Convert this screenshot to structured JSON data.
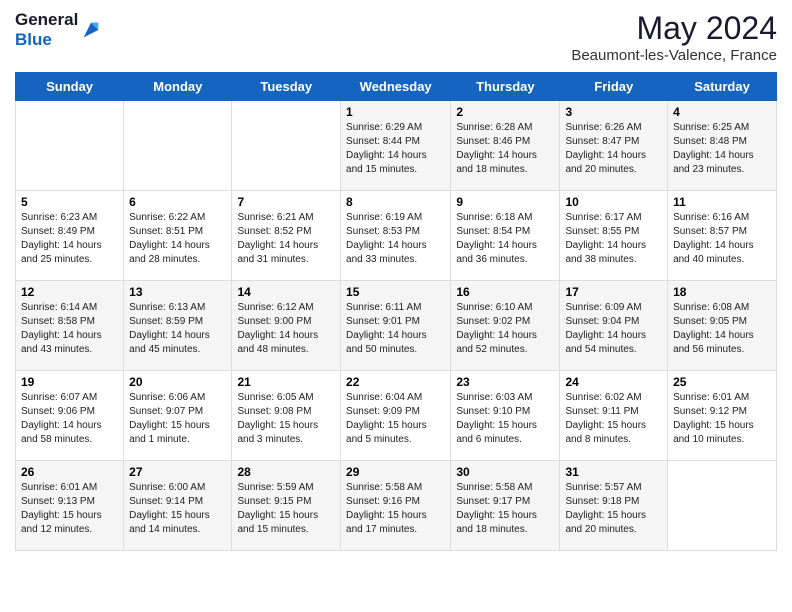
{
  "logo": {
    "line1": "General",
    "line2": "Blue"
  },
  "title": "May 2024",
  "location": "Beaumont-les-Valence, France",
  "weekdays": [
    "Sunday",
    "Monday",
    "Tuesday",
    "Wednesday",
    "Thursday",
    "Friday",
    "Saturday"
  ],
  "weeks": [
    [
      {
        "day": "",
        "info": ""
      },
      {
        "day": "",
        "info": ""
      },
      {
        "day": "",
        "info": ""
      },
      {
        "day": "1",
        "info": "Sunrise: 6:29 AM\nSunset: 8:44 PM\nDaylight: 14 hours\nand 15 minutes."
      },
      {
        "day": "2",
        "info": "Sunrise: 6:28 AM\nSunset: 8:46 PM\nDaylight: 14 hours\nand 18 minutes."
      },
      {
        "day": "3",
        "info": "Sunrise: 6:26 AM\nSunset: 8:47 PM\nDaylight: 14 hours\nand 20 minutes."
      },
      {
        "day": "4",
        "info": "Sunrise: 6:25 AM\nSunset: 8:48 PM\nDaylight: 14 hours\nand 23 minutes."
      }
    ],
    [
      {
        "day": "5",
        "info": "Sunrise: 6:23 AM\nSunset: 8:49 PM\nDaylight: 14 hours\nand 25 minutes."
      },
      {
        "day": "6",
        "info": "Sunrise: 6:22 AM\nSunset: 8:51 PM\nDaylight: 14 hours\nand 28 minutes."
      },
      {
        "day": "7",
        "info": "Sunrise: 6:21 AM\nSunset: 8:52 PM\nDaylight: 14 hours\nand 31 minutes."
      },
      {
        "day": "8",
        "info": "Sunrise: 6:19 AM\nSunset: 8:53 PM\nDaylight: 14 hours\nand 33 minutes."
      },
      {
        "day": "9",
        "info": "Sunrise: 6:18 AM\nSunset: 8:54 PM\nDaylight: 14 hours\nand 36 minutes."
      },
      {
        "day": "10",
        "info": "Sunrise: 6:17 AM\nSunset: 8:55 PM\nDaylight: 14 hours\nand 38 minutes."
      },
      {
        "day": "11",
        "info": "Sunrise: 6:16 AM\nSunset: 8:57 PM\nDaylight: 14 hours\nand 40 minutes."
      }
    ],
    [
      {
        "day": "12",
        "info": "Sunrise: 6:14 AM\nSunset: 8:58 PM\nDaylight: 14 hours\nand 43 minutes."
      },
      {
        "day": "13",
        "info": "Sunrise: 6:13 AM\nSunset: 8:59 PM\nDaylight: 14 hours\nand 45 minutes."
      },
      {
        "day": "14",
        "info": "Sunrise: 6:12 AM\nSunset: 9:00 PM\nDaylight: 14 hours\nand 48 minutes."
      },
      {
        "day": "15",
        "info": "Sunrise: 6:11 AM\nSunset: 9:01 PM\nDaylight: 14 hours\nand 50 minutes."
      },
      {
        "day": "16",
        "info": "Sunrise: 6:10 AM\nSunset: 9:02 PM\nDaylight: 14 hours\nand 52 minutes."
      },
      {
        "day": "17",
        "info": "Sunrise: 6:09 AM\nSunset: 9:04 PM\nDaylight: 14 hours\nand 54 minutes."
      },
      {
        "day": "18",
        "info": "Sunrise: 6:08 AM\nSunset: 9:05 PM\nDaylight: 14 hours\nand 56 minutes."
      }
    ],
    [
      {
        "day": "19",
        "info": "Sunrise: 6:07 AM\nSunset: 9:06 PM\nDaylight: 14 hours\nand 58 minutes."
      },
      {
        "day": "20",
        "info": "Sunrise: 6:06 AM\nSunset: 9:07 PM\nDaylight: 15 hours\nand 1 minute."
      },
      {
        "day": "21",
        "info": "Sunrise: 6:05 AM\nSunset: 9:08 PM\nDaylight: 15 hours\nand 3 minutes."
      },
      {
        "day": "22",
        "info": "Sunrise: 6:04 AM\nSunset: 9:09 PM\nDaylight: 15 hours\nand 5 minutes."
      },
      {
        "day": "23",
        "info": "Sunrise: 6:03 AM\nSunset: 9:10 PM\nDaylight: 15 hours\nand 6 minutes."
      },
      {
        "day": "24",
        "info": "Sunrise: 6:02 AM\nSunset: 9:11 PM\nDaylight: 15 hours\nand 8 minutes."
      },
      {
        "day": "25",
        "info": "Sunrise: 6:01 AM\nSunset: 9:12 PM\nDaylight: 15 hours\nand 10 minutes."
      }
    ],
    [
      {
        "day": "26",
        "info": "Sunrise: 6:01 AM\nSunset: 9:13 PM\nDaylight: 15 hours\nand 12 minutes."
      },
      {
        "day": "27",
        "info": "Sunrise: 6:00 AM\nSunset: 9:14 PM\nDaylight: 15 hours\nand 14 minutes."
      },
      {
        "day": "28",
        "info": "Sunrise: 5:59 AM\nSunset: 9:15 PM\nDaylight: 15 hours\nand 15 minutes."
      },
      {
        "day": "29",
        "info": "Sunrise: 5:58 AM\nSunset: 9:16 PM\nDaylight: 15 hours\nand 17 minutes."
      },
      {
        "day": "30",
        "info": "Sunrise: 5:58 AM\nSunset: 9:17 PM\nDaylight: 15 hours\nand 18 minutes."
      },
      {
        "day": "31",
        "info": "Sunrise: 5:57 AM\nSunset: 9:18 PM\nDaylight: 15 hours\nand 20 minutes."
      },
      {
        "day": "",
        "info": ""
      }
    ]
  ]
}
